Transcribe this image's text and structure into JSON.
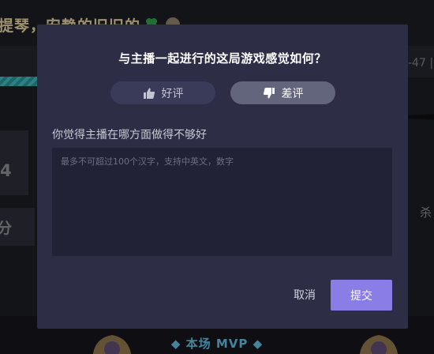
{
  "background": {
    "title": "提琴，安静的旧旧的",
    "right_text": "-47 |",
    "left_value_1": "4",
    "left_value_2": "分",
    "right_label": "杀",
    "mvp_label": "◆ 本场 MVP ◆"
  },
  "dialog": {
    "title": "与主播一起进行的这局游戏感觉如何？",
    "rating": {
      "good_label": "好评",
      "bad_label": "差评",
      "selected": "bad"
    },
    "question": "你觉得主播在哪方面做得不够好",
    "feedback": {
      "value": "",
      "placeholder": "最多不可超过100个汉字，支持中英文，数字"
    },
    "cancel_label": "取消",
    "submit_label": "提交",
    "colors": {
      "dialog_bg": "#2d2d46",
      "selected_pill": "#62657c",
      "unselected_pill": "#3a3b58",
      "submit_bg": "#8a7de6"
    }
  }
}
